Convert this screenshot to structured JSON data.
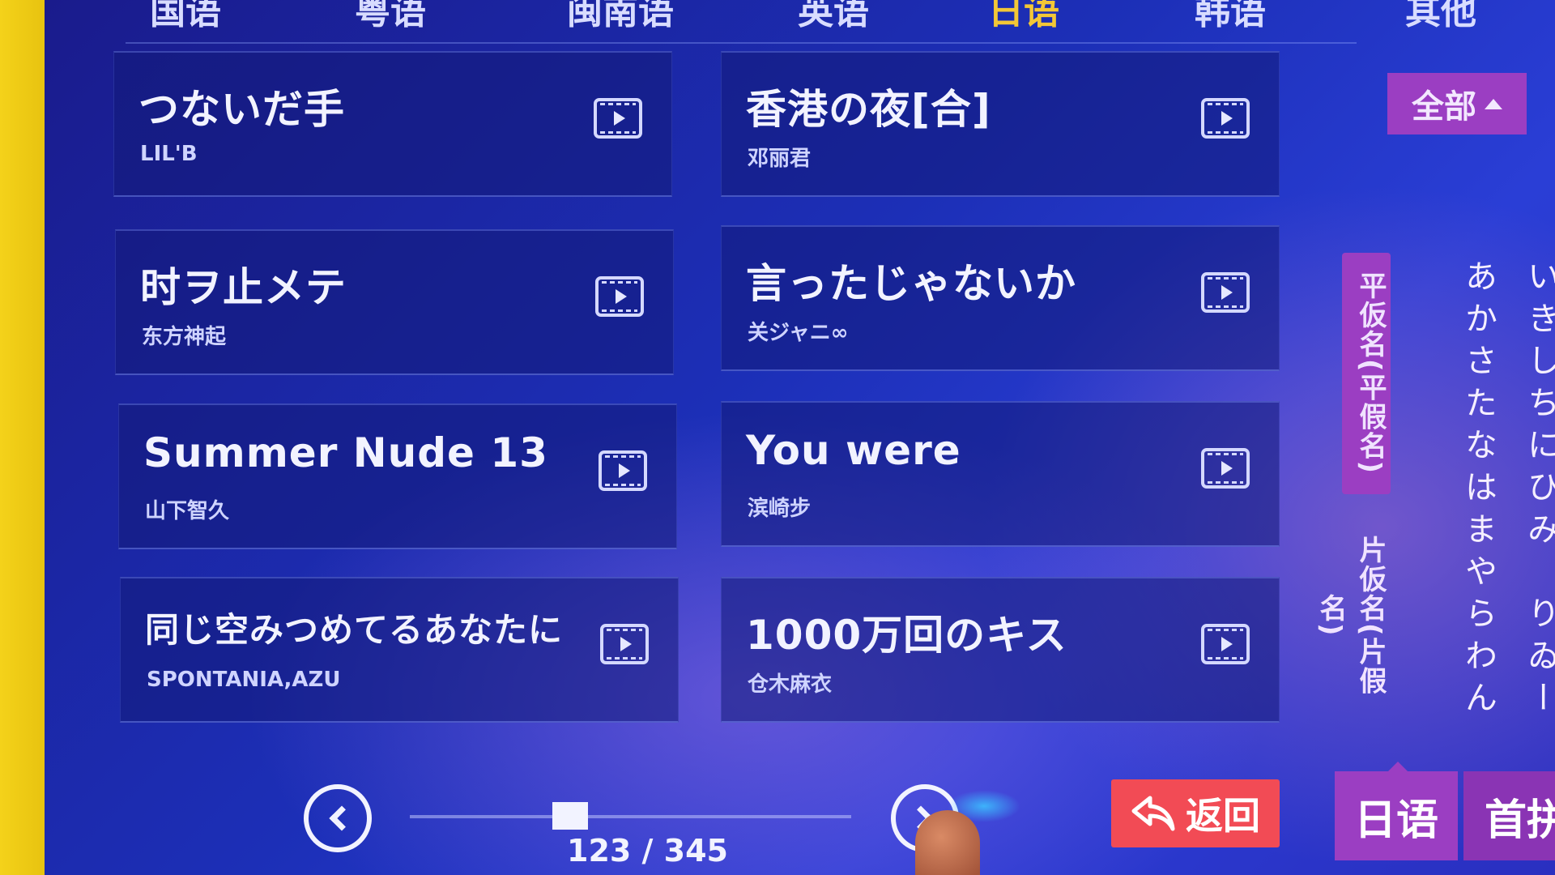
{
  "lang_tabs": [
    {
      "label": "国语",
      "active": false
    },
    {
      "label": "粤语",
      "active": false
    },
    {
      "label": "闽南语",
      "active": false
    },
    {
      "label": "英语",
      "active": false
    },
    {
      "label": "日语",
      "active": true
    },
    {
      "label": "韩语",
      "active": false
    },
    {
      "label": "其他",
      "active": false
    }
  ],
  "songs": [
    {
      "title": "つないだ手",
      "artist": "LIL'B"
    },
    {
      "title": "香港の夜[合]",
      "artist": "邓丽君"
    },
    {
      "title": "时ヲ止メテ",
      "artist": "东方神起"
    },
    {
      "title": "言ったじゃないか",
      "artist": "关ジャニ∞"
    },
    {
      "title": "Summer Nude 13",
      "artist": "山下智久"
    },
    {
      "title": "You were",
      "artist": "滨崎步"
    },
    {
      "title": "同じ空みつめてるあなたに",
      "artist": "SPONTANIA,AZU"
    },
    {
      "title": "1000万回のキス",
      "artist": "仓木麻衣"
    }
  ],
  "filter": {
    "all_label": "全部"
  },
  "kana": {
    "hiragana_label": "平仮名(平假名)",
    "katakana_label": "片仮名(片假名)",
    "row1": "あかさたなはまやらわん",
    "row2": "いきしちにひみ　りゐー"
  },
  "pagination": {
    "current": 123,
    "total": 345,
    "text": "123 / 345"
  },
  "back_label": "返回",
  "bottom_tabs": {
    "japanese": "日语",
    "initials": "首拼"
  },
  "colors": {
    "accent_purple": "#9b3ec2",
    "back_red": "#f24b55",
    "active_tab": "#f3c736"
  }
}
